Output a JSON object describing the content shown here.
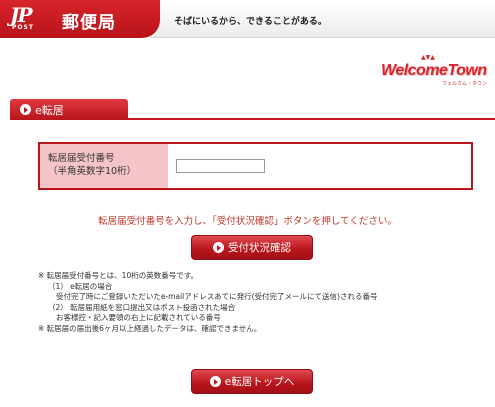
{
  "header": {
    "brand": "郵便局",
    "logo_mark": "JP",
    "logo_sub": "POST",
    "slogan": "そばにいるから、できることがある。"
  },
  "welcome_logo": {
    "text": "WelcomeTown",
    "sub": "ウェルカム・タウン"
  },
  "section_tab": {
    "icon": "play-circle-icon",
    "label": "e転居"
  },
  "form": {
    "label_line1": "転居届受付番号",
    "label_line2": "（半角英数字10桁）",
    "input_value": "",
    "input_placeholder": ""
  },
  "instruction": "転居届受付番号を入力し、「受付状況確認」ボタンを押してください。",
  "confirm_button": {
    "icon": "play-circle-icon",
    "label": "受付状況確認"
  },
  "notes": [
    "※ 転居届受付番号とは、10桁の英数番号です。",
    "（1） e転居の場合",
    "受付完了時にご登録いただいたe-mailアドレスあてに発行(受付完了メールにて送信)される番号",
    "（2） 転居届用紙を窓口提出又はポスト投函された場合",
    "お客様控・記入要領の右上に記載されている番号",
    "※ 転居届の届出後6ヶ月以上経過したデータは、確認できません。"
  ],
  "top_button": {
    "icon": "play-circle-icon",
    "label": "e転居トップへ"
  },
  "colors": {
    "brand_red": "#c8141b",
    "label_pink": "#f4c4c8",
    "instruction_red": "#c0392b"
  }
}
